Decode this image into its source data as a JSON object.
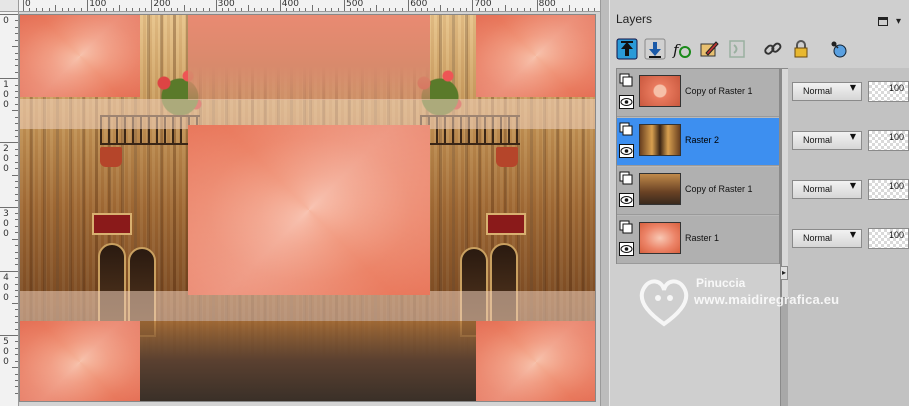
{
  "rulers": {
    "top_labels": [
      "0",
      "100",
      "200",
      "300",
      "400",
      "500",
      "600",
      "700",
      "800"
    ],
    "left_labels": [
      "0",
      "1\n0\n0",
      "2\n0\n0",
      "3\n0\n0",
      "4\n0\n0",
      "5\n0\n0"
    ]
  },
  "panel": {
    "title": "Layers",
    "menu_glyph": "▾"
  },
  "toolbar": {
    "buttons": [
      {
        "name": "move-layer-up-icon"
      },
      {
        "name": "move-layer-down-icon"
      },
      {
        "name": "fx-icon"
      },
      {
        "name": "edit-properties-icon"
      },
      {
        "name": "mask-icon"
      },
      {
        "name": "link-icon"
      },
      {
        "name": "lock-icon"
      },
      {
        "name": "new-layer-icon"
      }
    ]
  },
  "layers": [
    {
      "name": "Copy of Raster 1",
      "blend_mode": "Normal",
      "opacity": "100",
      "selected": false,
      "thumb": "salmon-dark"
    },
    {
      "name": "Raster 2",
      "blend_mode": "Normal",
      "opacity": "100",
      "selected": true,
      "thumb": "street"
    },
    {
      "name": "Copy of Raster 1",
      "blend_mode": "Normal",
      "opacity": "100",
      "selected": false,
      "thumb": "brown"
    },
    {
      "name": "Raster 1",
      "blend_mode": "Normal",
      "opacity": "100",
      "selected": false,
      "thumb": "salmon"
    }
  ],
  "watermark": {
    "name": "Pinuccia",
    "url": "www.maidiregrafica.eu"
  },
  "colors": {
    "selection": "#3d8ff0",
    "salmon": "#ec8468",
    "panel_bg": "#cfcfcf"
  }
}
